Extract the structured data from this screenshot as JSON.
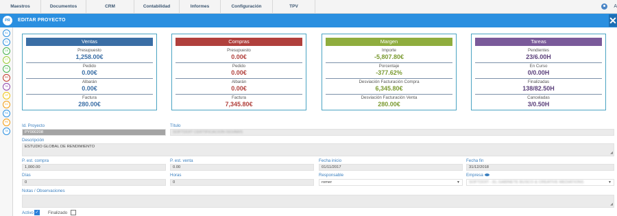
{
  "nav": {
    "items": [
      "Maestros",
      "Documentos",
      "CRM",
      "Contabilidad",
      "Informes",
      "Configuración",
      "TPV"
    ],
    "user_icon": "user-circle-icon",
    "extra": "A"
  },
  "header": {
    "badge": "PR",
    "title": "EDITAR PROYECTO",
    "close": "✕"
  },
  "rail": {
    "items": [
      {
        "label": "AL",
        "color": "#2a8fe0"
      },
      {
        "label": "CL",
        "color": "#2a8fe0"
      },
      {
        "label": "CE",
        "color": "#44b24b"
      },
      {
        "label": "CT",
        "color": "#9acd32"
      },
      {
        "label": "FA",
        "color": "#44b24b"
      },
      {
        "label": "PR",
        "color": "#c0392b"
      },
      {
        "label": "TA",
        "color": "#8e44ad"
      },
      {
        "label": "OF",
        "color": "#f1c40f"
      },
      {
        "label": "CC",
        "color": "#f39c12"
      },
      {
        "label": "FA",
        "color": "#2a8fe0"
      },
      {
        "label": "PE",
        "color": "#f39c12"
      },
      {
        "label": "TA",
        "color": "#2a8fe0"
      }
    ]
  },
  "cards": [
    {
      "title": "Ventas",
      "head_color": "#3a6ea5",
      "value_color": "#3a6ea5",
      "stats": [
        {
          "label": "Presupuesto",
          "value": "1,258.00€"
        },
        {
          "label": "Pedido",
          "value": "0.00€"
        },
        {
          "label": "Albarán",
          "value": "0.00€"
        },
        {
          "label": "Factura",
          "value": "280.00€"
        }
      ]
    },
    {
      "title": "Compras",
      "head_color": "#b0403c",
      "value_color": "#b0403c",
      "stats": [
        {
          "label": "Presupuesto",
          "value": "0.00€"
        },
        {
          "label": "Pedido",
          "value": "0.00€"
        },
        {
          "label": "Albarán",
          "value": "0.00€"
        },
        {
          "label": "Factura",
          "value": "7,345.80€"
        }
      ]
    },
    {
      "title": "Margen",
      "head_color": "#8fad3e",
      "value_color": "#7a9a30",
      "stats": [
        {
          "label": "Importe",
          "value": "-5,807.80€"
        },
        {
          "label": "Porcentaje",
          "value": "-377.62%"
        },
        {
          "label": "Desviación Facturación Compra",
          "value": "6,345.80€"
        },
        {
          "label": "Desviación Facturación Venta",
          "value": "280.00€"
        }
      ]
    },
    {
      "title": "Tareas",
      "head_color": "#7a5a9a",
      "value_color": "#5a3f7a",
      "stats": [
        {
          "label": "Pendientes",
          "value": "23/6.00H"
        },
        {
          "label": "En Curso",
          "value": "0/0.00H"
        },
        {
          "label": "Finalizadas",
          "value": "138/82.50H"
        },
        {
          "label": "Canceladas",
          "value": "3/0.50H"
        }
      ]
    }
  ],
  "form": {
    "id_label": "Id. Proyecto",
    "id_value": "PY000208",
    "title_label": "Título",
    "title_value": "SOFTDOIT CERTIFICACION ISO/AWS",
    "desc_label": "Descripción",
    "desc_value": "ESTUDIO GLOBAL DE RENDIMIENTO",
    "p_compra_label": "P. est. compra",
    "p_compra_value": "1,000.00",
    "p_venta_label": "P. est. venta",
    "p_venta_value": "0.00",
    "fecha_inicio_label": "Fecha inicio",
    "fecha_inicio_value": "01/11/2017",
    "fecha_fin_label": "Fecha fin",
    "fecha_fin_value": "31/12/2018",
    "dias_label": "Días",
    "dias_value": "0",
    "horas_label": "Horas",
    "horas_value": "0",
    "responsable_label": "Responsable",
    "responsable_value": "romer",
    "empresa_label": "Empresa",
    "empresa_value": "SOFTDOIT - EL GABINETE BUSCO & CREATIVE MEDIATIONS",
    "notas_label": "Notas / Observaciones",
    "notas_value": "",
    "activo_label": "Activo",
    "finalizado_label": "Finalizado"
  }
}
